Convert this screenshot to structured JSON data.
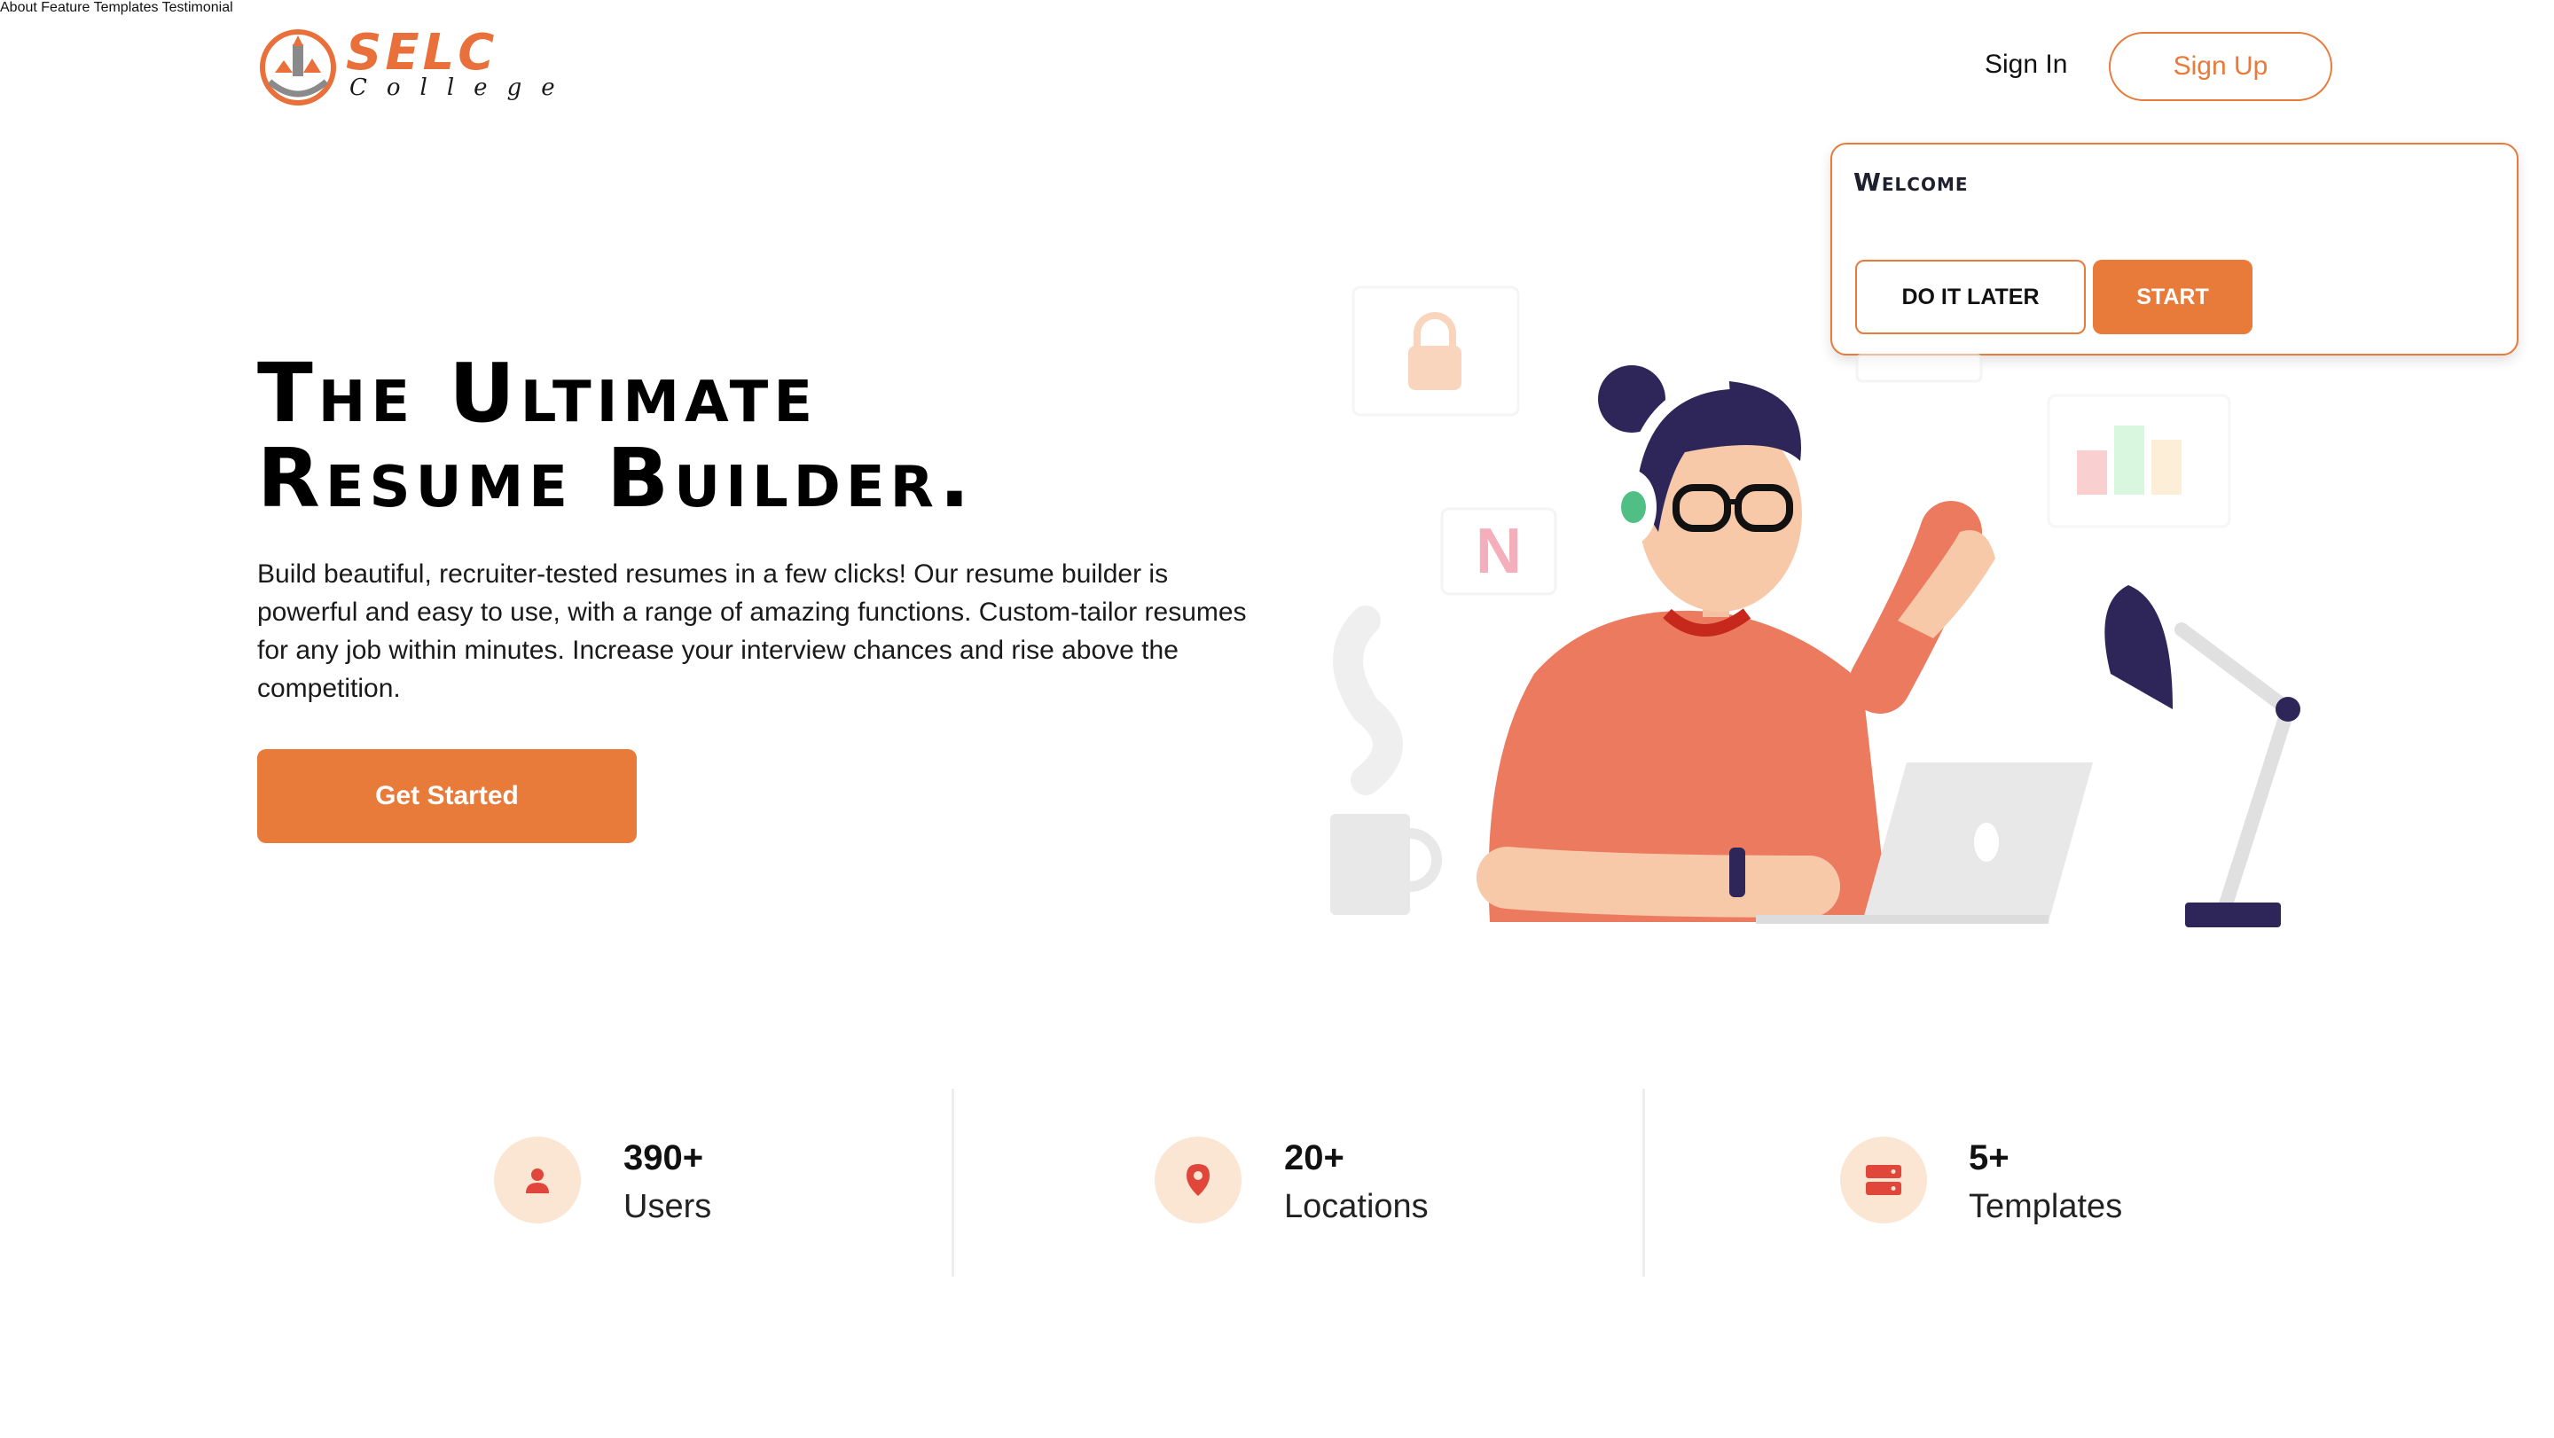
{
  "brand": {
    "name": "SELC",
    "sub": "College"
  },
  "nav": {
    "items": [
      {
        "label": "About"
      },
      {
        "label": "Feature"
      },
      {
        "label": "Templates"
      },
      {
        "label": "Testimonial"
      }
    ],
    "signin": "Sign In",
    "signup": "Sign Up"
  },
  "welcome": {
    "title": "Welcome",
    "later": "DO IT LATER",
    "start": "START"
  },
  "hero": {
    "title_line1": "The Ultimate",
    "title_line2": "Resume Builder.",
    "description": "Build beautiful, recruiter-tested resumes in a few clicks! Our resume builder is powerful and easy to use, with a range of amazing functions. Custom-tailor resumes for any job within minutes. Increase your interview chances and rise above the competition.",
    "cta": "Get Started",
    "illustration_badge": "N"
  },
  "stats": [
    {
      "value": "390+",
      "label": "Users",
      "icon": "user-icon"
    },
    {
      "value": "20+",
      "label": "Locations",
      "icon": "location-pin-icon"
    },
    {
      "value": "5+",
      "label": "Templates",
      "icon": "server-icon"
    }
  ],
  "colors": {
    "accent": "#e87a3a",
    "icon_bg": "#fbe6d4",
    "icon_red": "#e0463a"
  }
}
